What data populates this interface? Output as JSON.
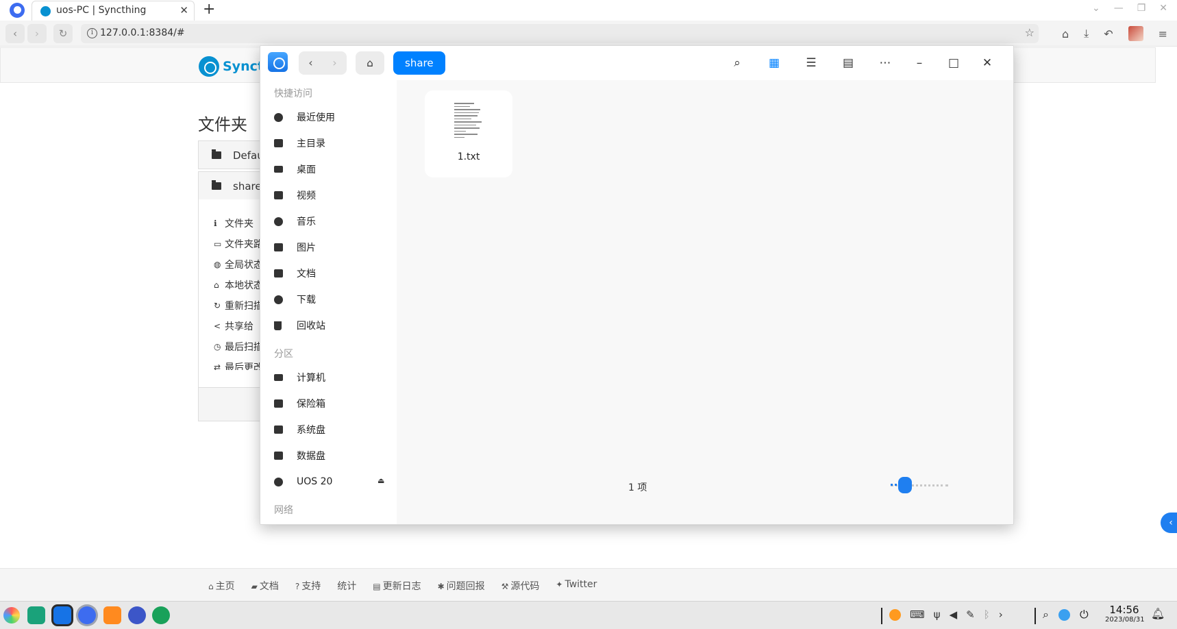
{
  "browser": {
    "tab_title": "uos-PC | Syncthing",
    "tab_close": "✕",
    "new_tab": "+",
    "url": "127.0.0.1:8384/#",
    "window_controls": [
      "⌄",
      "—",
      "❐",
      "✕"
    ]
  },
  "syncthing": {
    "brand": "Syncth",
    "folders_heading": "文件夹",
    "folders": [
      "Defau",
      "share"
    ],
    "folder_info": [
      "文件夹",
      "文件夹路",
      "全局状态",
      "本地状态",
      "重新扫描",
      "共享给",
      "最后扫描",
      "最后更改"
    ],
    "footer_links": [
      "主页",
      "文档",
      "支持",
      "统计",
      "更新日志",
      "问题回报",
      "源代码",
      "Twitter"
    ]
  },
  "file_manager": {
    "breadcrumb": "share",
    "quick_access_label": "快捷访问",
    "quick_access": [
      "最近使用",
      "主目录",
      "桌面",
      "视频",
      "音乐",
      "图片",
      "文档",
      "下载",
      "回收站"
    ],
    "partitions_label": "分区",
    "partitions": [
      "计算机",
      "保险箱",
      "系统盘",
      "数据盘",
      "UOS 20"
    ],
    "network_label": "网络",
    "files": [
      {
        "name": "1.txt"
      }
    ],
    "item_count": "1 项",
    "icon_zoom": 0.25,
    "icons": [
      "search-icon",
      "icon-view-icon",
      "list-view-icon",
      "tree-view-icon",
      "more-icon",
      "minimize-icon",
      "maximize-icon",
      "close-icon"
    ]
  },
  "taskbar": {
    "time": "14:56",
    "date": "2023/08/31"
  },
  "colors": {
    "accent": "#0081ff",
    "syncthing_brand": "#0891d1"
  }
}
